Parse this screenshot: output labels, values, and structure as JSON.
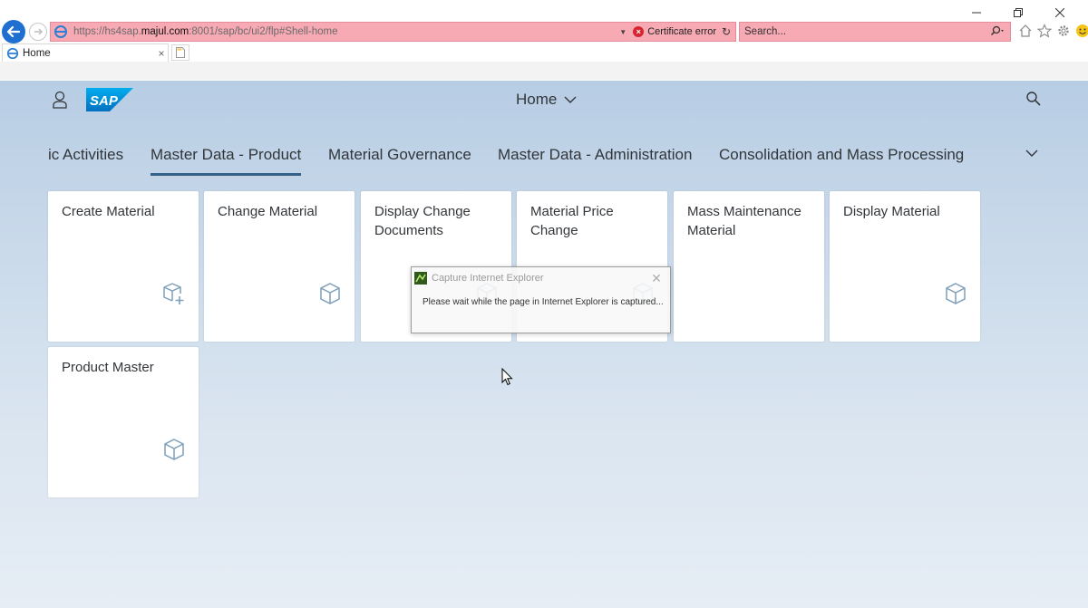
{
  "browser": {
    "url_prefix": "https://hs4sap.",
    "url_host": "majul.com",
    "url_suffix": ":8001/sap/bc/ui2/flp#Shell-home",
    "cert_error": "Certificate error",
    "search_placeholder": "Search...",
    "tab_title": "Home"
  },
  "shell": {
    "title": "Home"
  },
  "anchor_tabs": [
    {
      "label": "ic Activities"
    },
    {
      "label": "Master Data - Product",
      "selected": true
    },
    {
      "label": "Material Governance"
    },
    {
      "label": "Master Data - Administration"
    },
    {
      "label": "Consolidation and Mass Processing"
    }
  ],
  "tiles": [
    {
      "title": "Create Material",
      "icon": "create-cube-icon"
    },
    {
      "title": "Change Material",
      "icon": "cube-icon"
    },
    {
      "title": "Display Change Documents",
      "icon": "cube-icon"
    },
    {
      "title": "Material Price Change",
      "icon": "cube-icon"
    },
    {
      "title": "Mass Maintenance Material",
      "icon": "cube-icon"
    },
    {
      "title": "Display Material",
      "icon": "cube-icon"
    },
    {
      "title": "Product Master",
      "icon": "cube-icon"
    }
  ],
  "dialog": {
    "title": "Capture Internet Explorer",
    "message": "Please wait while the page in Internet Explorer is captured..."
  },
  "colors": {
    "sap_blue": "#0a6ed1",
    "selected_tab_underline": "#346187",
    "address_bar_error": "#f7a9b4"
  }
}
